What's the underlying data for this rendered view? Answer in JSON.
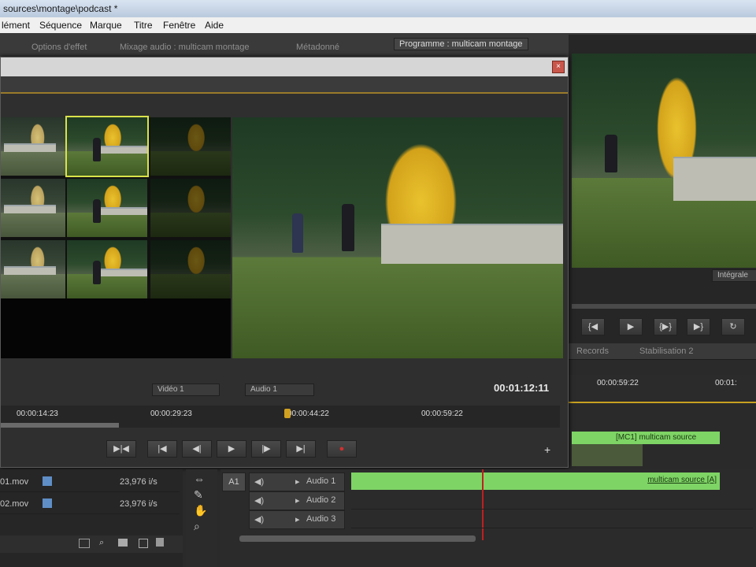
{
  "window": {
    "title": "sources\\montage\\podcast *"
  },
  "menu": [
    "lément",
    "Séquence",
    "Marque",
    "Titre",
    "Fenêtre",
    "Aide"
  ],
  "panel_tabs": {
    "effect_options": "Options d'effet",
    "audio_mixer": "Mixage audio : multicam montage",
    "metadata": "Métadonné",
    "program": "Programme : multicam montage"
  },
  "multicam": {
    "source_video": "Vidéo 1",
    "source_audio": "Audio 1",
    "timecode": "00:01:12:11",
    "ruler": [
      "00:00:14:23",
      "00:00:29:23",
      "00:00:44:22",
      "00:00:59:22"
    ],
    "controls": [
      "▶|◀",
      "|◀",
      "◀|",
      "▶",
      "|▶",
      "▶|",
      "●"
    ],
    "plus": "+"
  },
  "program": {
    "fit": "Intégrale",
    "ruler_tc": "00:00:59:22",
    "ruler_tc2": "00:01:",
    "controls": [
      "{◀",
      "▶",
      "{▶}",
      "▶}",
      "↻"
    ],
    "tabs": [
      "Records",
      "Stabilisation 2"
    ]
  },
  "timeline": {
    "clip_video": "[MC1] multicam source",
    "clip_audio": "multicam source [A]",
    "tracks": [
      {
        "id": "A1",
        "label": "Audio 1"
      },
      {
        "label": "Audio 2"
      },
      {
        "label": "Audio 3"
      }
    ]
  },
  "project": {
    "rows": [
      {
        "name": "01.mov",
        "rate": "23,976 i/s"
      },
      {
        "name": "02.mov",
        "rate": "23,976 i/s"
      }
    ]
  },
  "colors": {
    "accent": "#c8d23a",
    "clip_green": "#7ed465",
    "selection": "#d9e24a",
    "playhead": "#d0a020"
  }
}
